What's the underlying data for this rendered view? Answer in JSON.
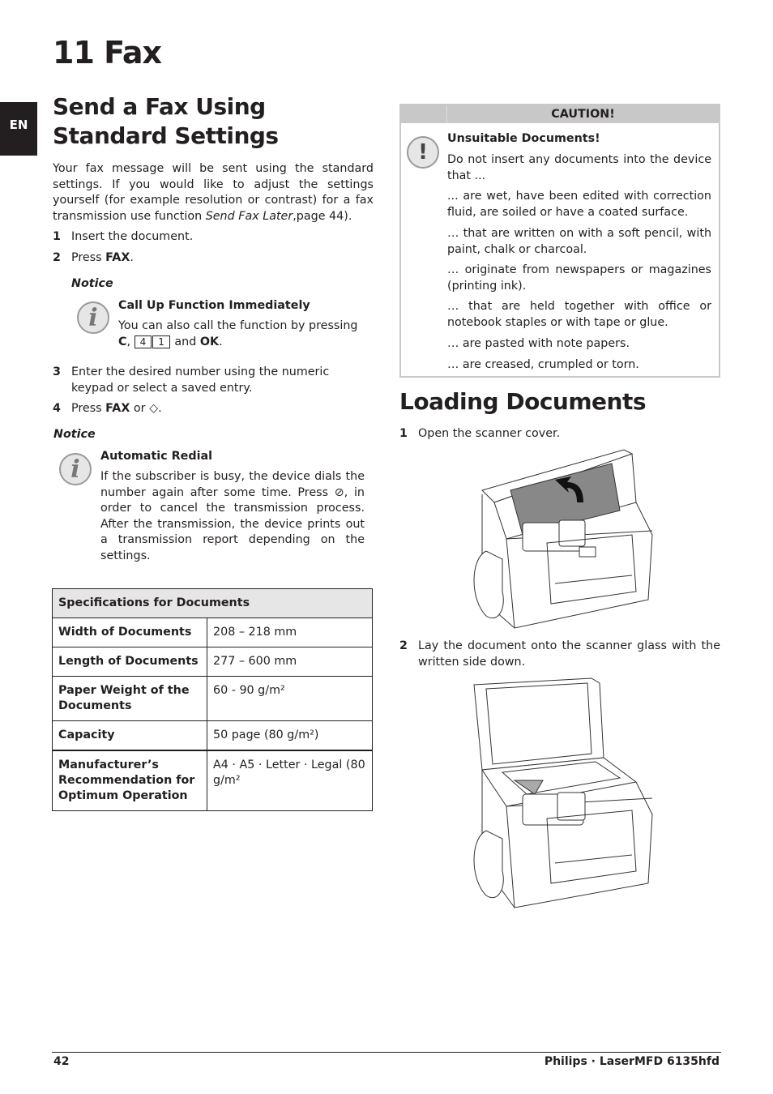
{
  "chapter": {
    "title": "11 Fax"
  },
  "lang_tab": "EN",
  "left": {
    "heading": "Send a Fax Using Standard Settings",
    "intro_pre": "Your fax message will be sent using the standard settings. If you would like to adjust the settings yourself (for example resolution or contrast) for a fax transmission use function ",
    "intro_em": "Send Fax Later",
    "intro_post": ",page  44).",
    "steps": [
      {
        "num": "1",
        "text": "Insert the document."
      },
      {
        "num": "2",
        "pre": "Press ",
        "bold": "FAX",
        "post": "."
      },
      {
        "num": "3",
        "text": "Enter the desired number using the numeric keypad or select a saved entry."
      },
      {
        "num": "4",
        "pre": "Press ",
        "bold": "FAX",
        "post": " or ",
        "icon": "start-icon",
        "icon_glyph": "◇",
        "post2": "."
      }
    ],
    "notice1": {
      "label": "Notice",
      "icon": "info-icon",
      "title": "Call Up Function Immediately",
      "text_pre": "You can also call the function by pressing ",
      "key_c": "C",
      "keys": [
        "4",
        "1"
      ],
      "text_mid": " and ",
      "key_ok": "OK",
      "text_post": "."
    },
    "notice2": {
      "label": "Notice",
      "icon": "info-icon",
      "title": "Automatic Redial",
      "text_pre": "If the subscriber is busy, the device dials the number again after some time. Press ",
      "stop_glyph": "⊘",
      "text_post": ", in order to cancel the transmission process. After the transmission, the device prints out a transmission report depending on the settings."
    },
    "spec_table": {
      "header": "Specifications for Documents",
      "rows": [
        {
          "key": "Width of Documents",
          "value": "208 – 218 mm"
        },
        {
          "key": "Length of Documents",
          "value": "277 – 600 mm"
        },
        {
          "key": "Paper Weight of the Documents",
          "value": "60 - 90 g/m²"
        },
        {
          "key": "Capacity",
          "value": "50 page (80 g/m²)"
        },
        {
          "key": "Manufacturer’s Recommendation for Optimum Operation",
          "value": "A4 · A5 · Letter · Legal (80 g/m²"
        }
      ]
    }
  },
  "right": {
    "caution": {
      "header": "CAUTION!",
      "icon": "exclamation-icon",
      "title": "Unsuitable Documents!",
      "intro": "Do not insert any documents into the device that ...",
      "items": [
        "... are wet, have been edited with correction fluid, are soiled or have a coated surface.",
        "… that are written on with a soft pencil, with paint, chalk or charcoal.",
        "… originate from newspapers or magazines (printing ink).",
        "… that are held together with office or notebook staples or with tape or glue.",
        "… are pasted with note papers.",
        "… are creased, crumpled or torn."
      ]
    },
    "heading": "Loading Documents",
    "steps": [
      {
        "num": "1",
        "text": "Open the scanner cover."
      },
      {
        "num": "2",
        "text": "Lay the document onto the scanner glass with the written side down."
      }
    ],
    "figures": [
      "printer-open-cover-illustration",
      "printer-document-on-glass-illustration"
    ]
  },
  "footer": {
    "page": "42",
    "product": "Philips · LaserMFD 6135hfd"
  }
}
